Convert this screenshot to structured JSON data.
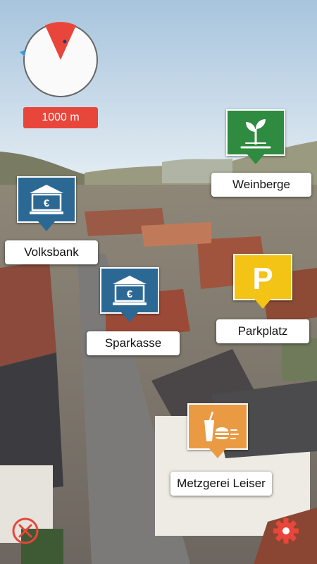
{
  "radar": {
    "distance_label": "1000 m"
  },
  "pois": [
    {
      "name": "Weinberge",
      "icon": "plant-icon",
      "color": "#2e8b3f"
    },
    {
      "name": "Volksbank",
      "icon": "bank-euro-icon",
      "color": "#2b6894"
    },
    {
      "name": "Sparkasse",
      "icon": "bank-euro-icon",
      "color": "#2b6894"
    },
    {
      "name": "Parkplatz",
      "icon": "parking-icon",
      "color": "#f3c416"
    },
    {
      "name": "Metzgerei Leiser",
      "icon": "food-drink-icon",
      "color": "#e99a42"
    }
  ],
  "bank_symbol": "€",
  "parking_symbol": "P",
  "controls": {
    "close_icon": "close-circle-icon",
    "settings_icon": "gear-icon",
    "accent": "#e9463b"
  }
}
